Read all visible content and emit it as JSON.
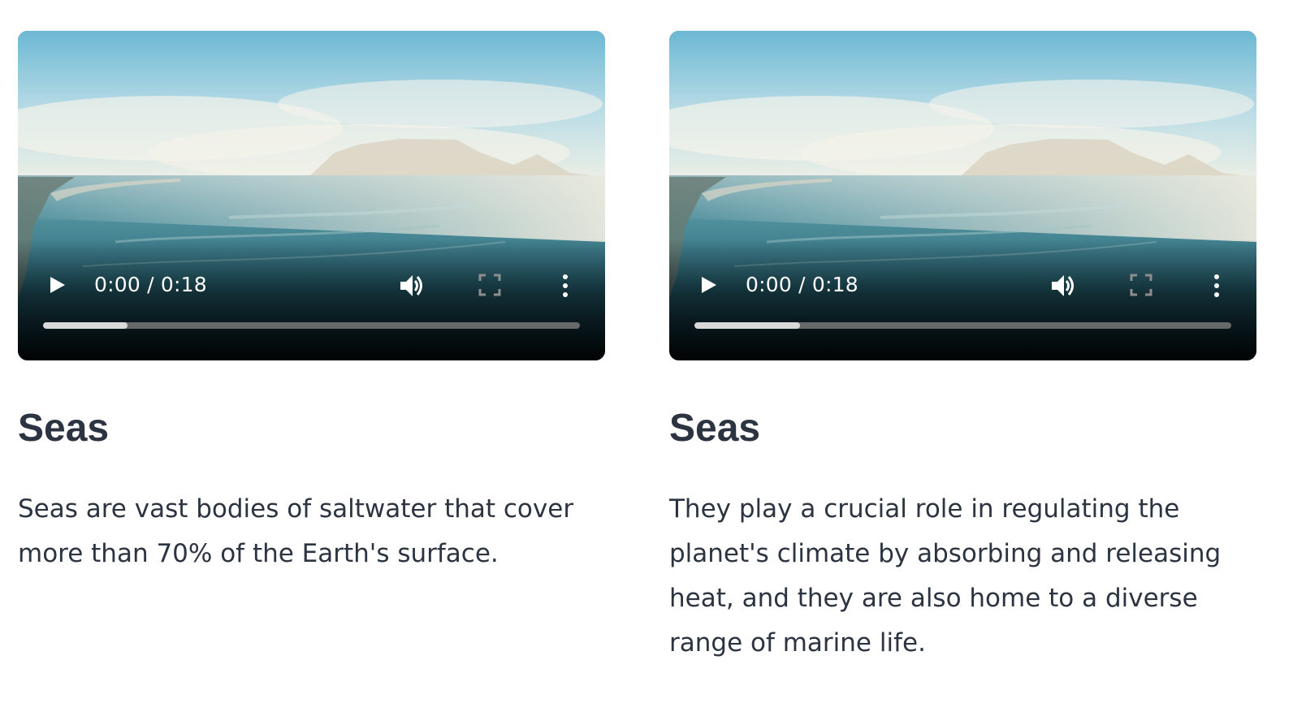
{
  "cards": [
    {
      "video": {
        "time": "0:00 / 0:18",
        "progress": 0.158
      },
      "title": "Seas",
      "description": "Seas are vast bodies of saltwater that cover more than 70% of the Earth's surface."
    },
    {
      "video": {
        "time": "0:00 / 0:18",
        "progress": 0.197
      },
      "title": "Seas",
      "description": "They play a crucial role in regulating the planet's climate by absorbing and releasing heat, and they are also home to a diverse range of marine life."
    }
  ],
  "icons": {
    "play": "play-icon",
    "volume": "volume-icon",
    "fullscreen": "fullscreen-icon",
    "more": "more-vertical-icon"
  },
  "colors": {
    "text": "#2b3440",
    "sea": "#2f6f80",
    "sky": "#cfe6ee"
  }
}
